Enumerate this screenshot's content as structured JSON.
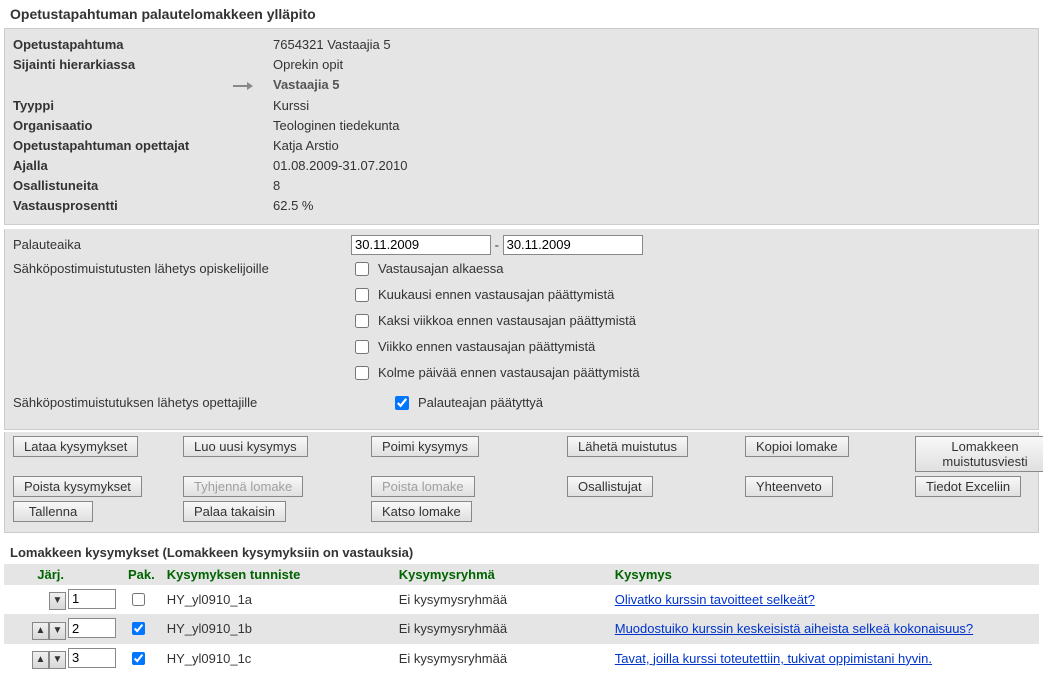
{
  "page": {
    "title": "Opetustapahtuman palautelomakkeen ylläpito"
  },
  "info": {
    "labels": {
      "opetustapahtuma": "Opetustapahtuma",
      "sijainti": "Sijainti hierarkiassa",
      "tyyppi": "Tyyppi",
      "organisaatio": "Organisaatio",
      "opettajat": "Opetustapahtuman opettajat",
      "ajalla": "Ajalla",
      "osallistuneita": "Osallistuneita",
      "vastausprosentti": "Vastausprosentti"
    },
    "values": {
      "opetustapahtuma": "7654321 Vastaajia 5",
      "sijainti_parent": "Oprekin opit",
      "sijainti_current": "Vastaajia 5",
      "tyyppi": "Kurssi",
      "organisaatio": "Teologinen tiedekunta",
      "opettajat": "Katja Arstio",
      "ajalla": "01.08.2009-31.07.2010",
      "osallistuneita": "8",
      "vastausprosentti": "62.5 %"
    }
  },
  "form": {
    "labels": {
      "palauteaika": "Palauteaika",
      "dash": "-",
      "smslah": "Sähköpostimuistutusten lähetys opiskelijoille",
      "smlahop": "Sähköpostimuistutuksen lähetys opettajille"
    },
    "dates": {
      "from": "30.11.2009",
      "to": "30.11.2009"
    },
    "reminders": {
      "r1": "Vastausajan alkaessa",
      "r2": "Kuukausi ennen vastausajan päättymistä",
      "r3": "Kaksi viikkoa ennen vastausajan päättymistä",
      "r4": "Viikko ennen vastausajan päättymistä",
      "r5": "Kolme päivää ennen vastausajan päättymistä",
      "teacher": "Palauteajan päätyttyä"
    }
  },
  "buttons": {
    "lataa": "Lataa kysymykset",
    "luouusi": "Luo uusi kysymys",
    "poimi": "Poimi kysymys",
    "laheta": "Lähetä muistutus",
    "kopioi": "Kopioi lomake",
    "lomakkeen": "Lomakkeen muistutusviesti",
    "poista": "Poista kysymykset",
    "tyhjenna": "Tyhjennä lomake",
    "poistalomake": "Poista lomake",
    "osallistujat": "Osallistujat",
    "yhteenveto": "Yhteenveto",
    "tiedot": "Tiedot Exceliin",
    "tallenna": "Tallenna",
    "palaa": "Palaa takaisin",
    "katso": "Katso lomake"
  },
  "questions": {
    "heading": "Lomakkeen kysymykset (Lomakkeen kysymyksiin on vastauksia)",
    "headers": {
      "jarj": "Järj.",
      "pak": "Pak.",
      "tunniste": "Kysymyksen tunniste",
      "ryhma": "Kysymysryhmä",
      "kysymys": "Kysymys"
    },
    "rows": [
      {
        "ord": "1",
        "pak": false,
        "tunniste": "HY_yl0910_1a",
        "ryhma": "Ei kysymysryhmää",
        "kysymys": "Olivatko kurssin tavoitteet selkeät?",
        "up": false,
        "down": true
      },
      {
        "ord": "2",
        "pak": true,
        "tunniste": "HY_yl0910_1b",
        "ryhma": "Ei kysymysryhmää",
        "kysymys": "Muodostuiko kurssin keskeisistä aiheista selkeä kokonaisuus?",
        "up": true,
        "down": true
      },
      {
        "ord": "3",
        "pak": true,
        "tunniste": "HY_yl0910_1c",
        "ryhma": "Ei kysymysryhmää",
        "kysymys": "Tavat, joilla kurssi toteutettiin, tukivat oppimistani hyvin.",
        "up": true,
        "down": true
      }
    ]
  }
}
